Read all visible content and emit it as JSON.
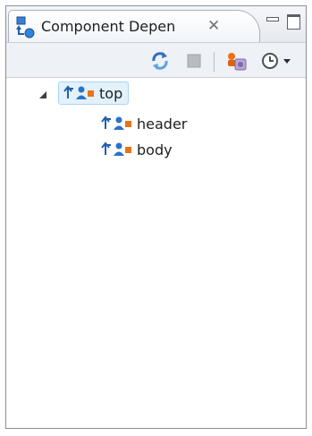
{
  "view": {
    "tab_title": "Component Depen",
    "icons": {
      "view": "component-dependency-icon",
      "close": "close-icon",
      "minimize": "minimize-icon",
      "maximize": "maximize-icon"
    },
    "close_glyph": "✕"
  },
  "toolbar": {
    "buttons": [
      {
        "name": "refresh",
        "icon": "refresh-icon",
        "enabled": true
      },
      {
        "name": "stop",
        "icon": "stop-icon",
        "enabled": false
      },
      {
        "name": "show-components",
        "icon": "components-filter-icon",
        "enabled": true
      },
      {
        "name": "history",
        "icon": "history-dropdown-icon",
        "enabled": true
      }
    ]
  },
  "tree": {
    "nodes": [
      {
        "label": "top",
        "level": 0,
        "expanded": true,
        "selected": true,
        "icon": "component-dependency-icon"
      },
      {
        "label": "header",
        "level": 1,
        "expanded": false,
        "selected": false,
        "icon": "component-dependency-icon"
      },
      {
        "label": "body",
        "level": 1,
        "expanded": false,
        "selected": false,
        "icon": "component-dependency-icon"
      }
    ]
  },
  "colors": {
    "arrow": "#1f5fae",
    "person": "#2a73c5",
    "component": "#e8731a",
    "selection": "#e3f1fb"
  }
}
